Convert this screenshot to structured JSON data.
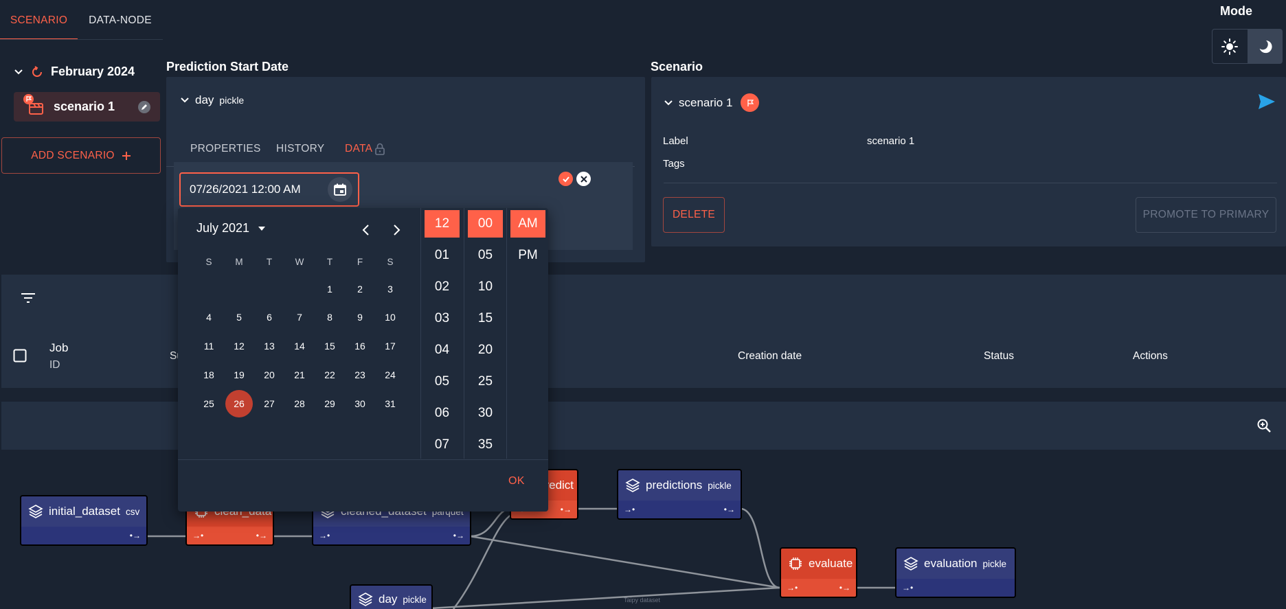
{
  "tabs": [
    "SCENARIO",
    "DATA-NODE"
  ],
  "mode": {
    "label": "Mode"
  },
  "tree": {
    "cycle_label": "February 2024",
    "scenario_label": "scenario 1"
  },
  "add_scenario_label": "ADD SCENARIO",
  "data_node": {
    "section_title": "Prediction Start Date",
    "name": "day",
    "type": "pickle",
    "tabs": [
      "PROPERTIES",
      "HISTORY",
      "DATA"
    ],
    "date_value": "07/26/2021 12:00 AM"
  },
  "scenario": {
    "section_title": "Scenario",
    "name": "scenario 1",
    "label_key": "Label",
    "label_value": "scenario 1",
    "tags_key": "Tags",
    "delete_label": "DELETE",
    "promote_label": "PROMOTE TO PRIMARY"
  },
  "jobs": {
    "headers": {
      "job": "Job",
      "id": "ID",
      "submitted_short": "Su",
      "creation_date": "Creation date",
      "status": "Status",
      "actions": "Actions"
    }
  },
  "dag": {
    "nodes": [
      {
        "name": "initial_dataset",
        "type": "csv",
        "kind": "data"
      },
      {
        "name": "clean_data",
        "type": "",
        "kind": "task"
      },
      {
        "name": "cleaned_dataset",
        "type": "parquet",
        "kind": "data"
      },
      {
        "name": "predict",
        "type": "",
        "kind": "task"
      },
      {
        "name": "predictions",
        "type": "pickle",
        "kind": "data"
      },
      {
        "name": "evaluate",
        "type": "",
        "kind": "task"
      },
      {
        "name": "evaluation",
        "type": "pickle",
        "kind": "data"
      },
      {
        "name": "day",
        "type": "pickle",
        "kind": "data"
      }
    ],
    "faint_label": "Taipy dataset"
  },
  "picker": {
    "month_label": "July 2021",
    "weekdays": [
      "S",
      "M",
      "T",
      "W",
      "T",
      "F",
      "S"
    ],
    "days": [
      "1",
      "2",
      "3",
      "4",
      "5",
      "6",
      "7",
      "8",
      "9",
      "10",
      "11",
      "12",
      "13",
      "14",
      "15",
      "16",
      "17",
      "18",
      "19",
      "20",
      "21",
      "22",
      "23",
      "24",
      "25",
      "26",
      "27",
      "28",
      "29",
      "30",
      "31"
    ],
    "first_weekday_index": 4,
    "selected_day": "26",
    "hours": [
      "12",
      "01",
      "02",
      "03",
      "04",
      "05",
      "06",
      "07"
    ],
    "minutes": [
      "00",
      "05",
      "10",
      "15",
      "20",
      "25",
      "30",
      "35"
    ],
    "ampm": [
      "AM",
      "PM"
    ],
    "selected_hour": "12",
    "selected_minute": "00",
    "selected_ampm": "AM",
    "ok_label": "OK"
  },
  "colors": {
    "accent": "#ff6149",
    "background": "#1a2331",
    "panel": "#243042",
    "data_node": "#2b3479",
    "task_node": "#e34f35",
    "send": "#29a3e8"
  }
}
